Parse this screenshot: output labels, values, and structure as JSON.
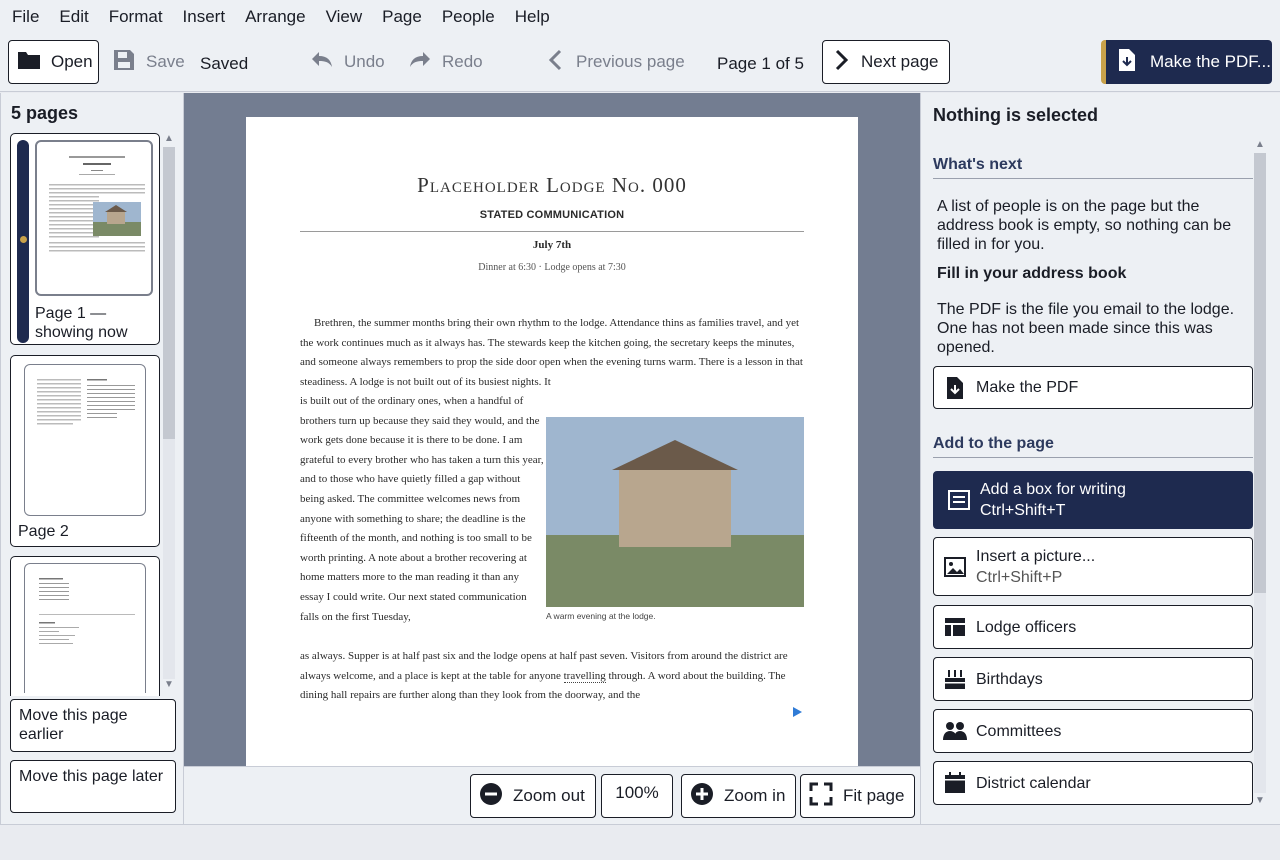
{
  "menu": [
    "File",
    "Edit",
    "Format",
    "Insert",
    "Arrange",
    "View",
    "Page",
    "People",
    "Help"
  ],
  "toolbar": {
    "open": "Open",
    "save": "Save",
    "saved_status": "Saved",
    "undo": "Undo",
    "redo": "Redo",
    "previous_page": "Previous page",
    "page_indicator": "Page 1 of 5",
    "next_page": "Next page",
    "make_pdf": "Make the PDF..."
  },
  "pages_panel": {
    "title": "5 pages",
    "thumbnails": [
      {
        "label": "Page 1 — showing now",
        "current": true
      },
      {
        "label": "Page 2",
        "current": false
      },
      {
        "label": "",
        "current": false
      }
    ],
    "move_earlier": "Move this page earlier",
    "move_later": "Move this page later"
  },
  "document": {
    "lodge_name": "Placeholder Lodge No. 000",
    "heading": "STATED COMMUNICATION",
    "date": "July 7th",
    "times": "Dinner at 6:30 · Lodge opens at 7:30",
    "para1": "Brethren, the summer months bring their own rhythm to the lodge. Attendance thins as families travel, and yet the work continues much as it always has. The stewards keep the kitchen going, the secretary keeps the minutes, and someone always remembers to prop the side door open when the evening turns warm. There is a lesson in that steadiness. A lodge is not built out of its busiest nights. It",
    "para1_narrow": "is built out of the ordinary ones, when a handful of brothers turn up because they said they would, and the work gets done because it is there to be done. I am grateful to every brother who has taken a turn this year, and to those who have quietly filled a gap without being asked. The committee welcomes news from anyone with something to share; the deadline is the fifteenth of the month, and nothing is too small to be worth printing. A note about a brother recovering at home matters more to the man reading it than any essay I could write. Our next stated communication falls on the first Tuesday,",
    "para1_after_a": "as always. Supper is at half past six and the lodge opens at half past seven. Visitors from around the district are always welcome, and a place is kept at the table for anyone ",
    "para1_after_flagged": "travelling",
    "para1_after_b": " through. A word about the building. The dining hall repairs are further along than they look from the doorway, and the",
    "picture_caption": "A warm evening at the lodge."
  },
  "zoom": {
    "zoom_out": "Zoom out",
    "level": "100%",
    "zoom_in": "Zoom in",
    "fit_page": "Fit page"
  },
  "side_panel": {
    "title": "Nothing is selected",
    "whats_next_heading": "What's next",
    "address_msg": "A list of people is on the page but the address book is empty, so nothing can be filled in for you.",
    "fill_address": "Fill in your address book",
    "pdf_msg": "The PDF is the file you email to the lodge. One has not been made since this was opened.",
    "make_pdf": "Make the PDF",
    "add_heading": "Add to the page",
    "add_items": [
      {
        "label": "Add a box for writing",
        "shortcut": "Ctrl+Shift+T",
        "icon": "text-box-icon"
      },
      {
        "label": "Insert a picture...",
        "shortcut": "Ctrl+Shift+P",
        "icon": "picture-icon"
      },
      {
        "label": "Lodge officers",
        "shortcut": "",
        "icon": "table-icon"
      },
      {
        "label": "Birthdays",
        "shortcut": "",
        "icon": "cake-icon"
      },
      {
        "label": "Committees",
        "shortcut": "",
        "icon": "people-icon"
      },
      {
        "label": "District calendar",
        "shortcut": "",
        "icon": "calendar-icon"
      }
    ]
  },
  "colors": {
    "accent_navy": "#1e2a4f",
    "accent_gold": "#c9a24a",
    "canvas_bg": "#737d91"
  }
}
